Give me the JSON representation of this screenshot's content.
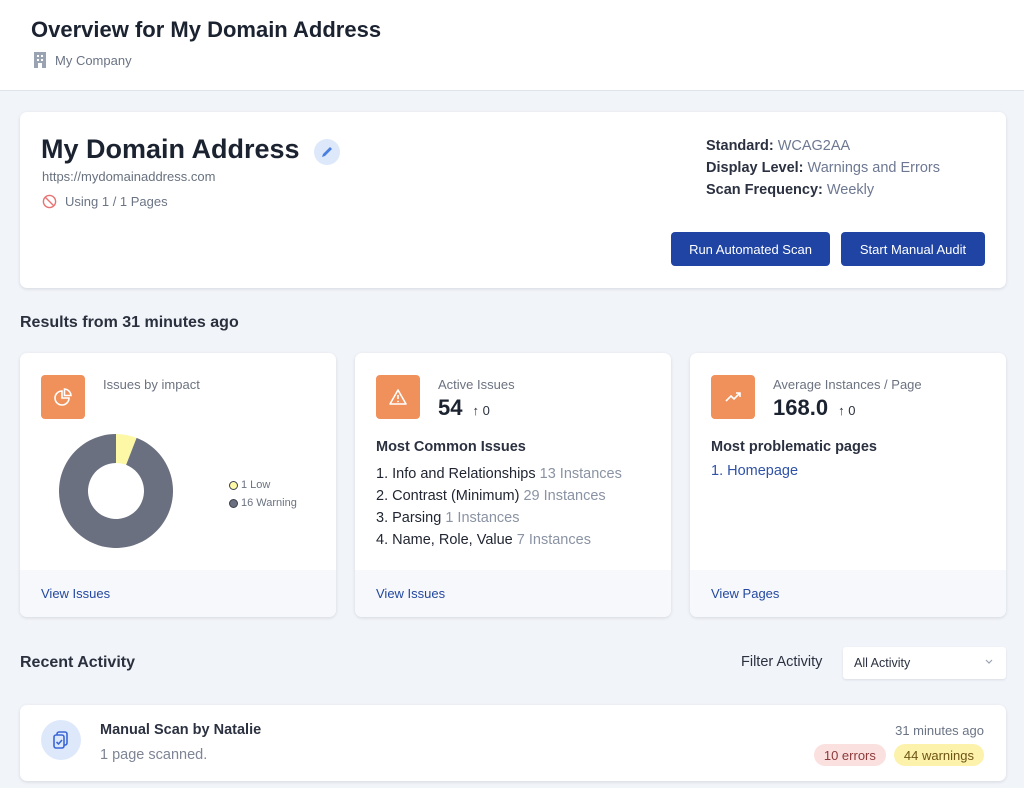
{
  "header": {
    "title": "Overview for My Domain Address",
    "company": "My Company"
  },
  "domain": {
    "name": "My Domain Address",
    "url": "https://mydomainaddress.com",
    "pages_used": "Using 1 / 1 Pages",
    "settings": [
      {
        "key": "Standard:",
        "value": "WCAG2AA"
      },
      {
        "key": "Display Level:",
        "value": "Warnings and Errors"
      },
      {
        "key": "Scan Frequency:",
        "value": "Weekly"
      }
    ],
    "run_scan_label": "Run Automated Scan",
    "manual_audit_label": "Start Manual Audit"
  },
  "results_title": "Results from 31 minutes ago",
  "impact_card": {
    "label": "Issues by impact",
    "link": "View Issues"
  },
  "chart_data": {
    "type": "pie",
    "title": "Issues by impact",
    "slices": [
      {
        "label": "Low",
        "value": 1,
        "color": "#fdf8a6"
      },
      {
        "label": "Warning",
        "value": 16,
        "color": "#6b7080"
      }
    ],
    "legend": [
      "1 Low",
      "16 Warning"
    ],
    "legend_position": "right",
    "donut": true
  },
  "active_card": {
    "label": "Active Issues",
    "value": "54",
    "delta": "0",
    "subtitle": "Most Common Issues",
    "issues": [
      {
        "name": "1. Info and Relationships",
        "count": "13 Instances"
      },
      {
        "name": "2. Contrast (Minimum)",
        "count": "29 Instances"
      },
      {
        "name": "3. Parsing",
        "count": "1 Instances"
      },
      {
        "name": "4. Name, Role, Value",
        "count": "7 Instances"
      }
    ],
    "link": "View Issues"
  },
  "avg_card": {
    "label": "Average Instances / Page",
    "value": "168.0",
    "delta": "0",
    "subtitle": "Most problematic pages",
    "pages": [
      "1. Homepage"
    ],
    "link": "View Pages"
  },
  "activity": {
    "title": "Recent Activity",
    "filter_label": "Filter Activity",
    "filter_value": "All Activity",
    "items": [
      {
        "title": "Manual Scan by Natalie",
        "desc": "1 page scanned.",
        "time": "31 minutes ago",
        "errors": "10 errors",
        "warnings": "44 warnings"
      }
    ]
  },
  "colors": {
    "accent": "#1f44a3",
    "icon_bg": "#f0905a",
    "link": "#2448a0"
  }
}
